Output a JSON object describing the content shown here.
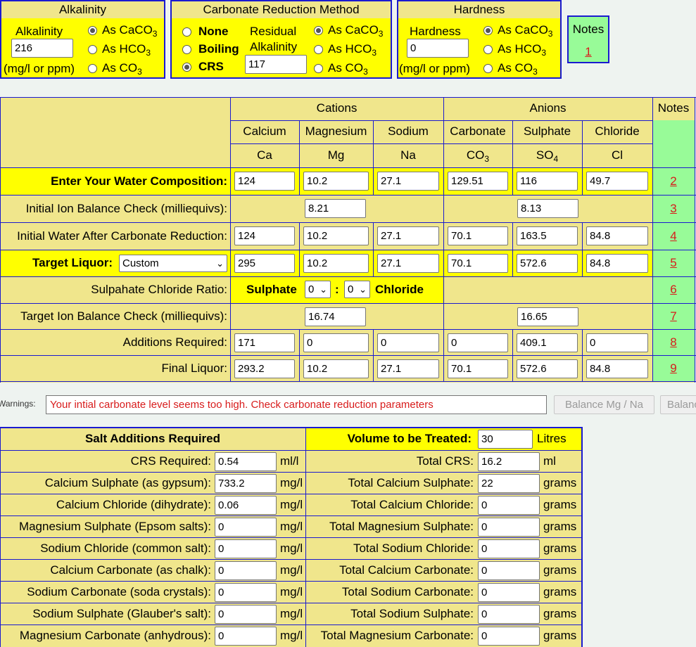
{
  "alkalinity": {
    "title": "Alkalinity",
    "label": "Alkalinity",
    "value": "216",
    "unit": "(mg/l or ppm)",
    "options": [
      {
        "pre": "As CaCO",
        "sub": "3",
        "selected": true
      },
      {
        "pre": "As HCO",
        "sub": "3",
        "selected": false
      },
      {
        "pre": "As CO",
        "sub": "3",
        "selected": false
      }
    ]
  },
  "reduction": {
    "title": "Carbonate Reduction Method",
    "methods": [
      {
        "label": "None",
        "selected": false
      },
      {
        "label": "Boiling",
        "selected": false
      },
      {
        "label": "CRS",
        "selected": true
      }
    ],
    "residual_label_1": "Residual",
    "residual_label_2": "Alkalinity",
    "residual_value": "117",
    "options": [
      {
        "pre": "As CaCO",
        "sub": "3",
        "selected": true
      },
      {
        "pre": "As HCO",
        "sub": "3",
        "selected": false
      },
      {
        "pre": "As CO",
        "sub": "3",
        "selected": false
      }
    ]
  },
  "hardness": {
    "title": "Hardness",
    "label": "Hardness",
    "value": "0",
    "unit": "(mg/l or ppm)",
    "options": [
      {
        "pre": "As CaCO",
        "sub": "3",
        "selected": true
      },
      {
        "pre": "As HCO",
        "sub": "3",
        "selected": false
      },
      {
        "pre": "As CO",
        "sub": "3",
        "selected": false
      }
    ]
  },
  "notes_box": {
    "title": "Notes",
    "link": "1"
  },
  "main": {
    "cations_header": "Cations",
    "anions_header": "Anions",
    "notes_header": "Notes",
    "columns": [
      {
        "name": "Calcium",
        "sym_pre": "Ca",
        "sym_sub": ""
      },
      {
        "name": "Magnesium",
        "sym_pre": "Mg",
        "sym_sub": ""
      },
      {
        "name": "Sodium",
        "sym_pre": "Na",
        "sym_sub": ""
      },
      {
        "name": "Carbonate",
        "sym_pre": "CO",
        "sym_sub": "3"
      },
      {
        "name": "Sulphate",
        "sym_pre": "SO",
        "sym_sub": "4"
      },
      {
        "name": "Chloride",
        "sym_pre": "Cl",
        "sym_sub": ""
      }
    ],
    "rows": [
      {
        "label": "Enter Your Water Composition:",
        "bold": true,
        "yellow": true,
        "values": [
          "124",
          "10.2",
          "27.1",
          "129.51",
          "116",
          "49.7"
        ],
        "note": "2"
      },
      {
        "label": "Initial Ion Balance Check (milliequivs):",
        "cation_balance": "8.21",
        "anion_balance": "8.13",
        "note": "3"
      },
      {
        "label": "Initial Water After Carbonate Reduction:",
        "values": [
          "124",
          "10.2",
          "27.1",
          "70.1",
          "163.5",
          "84.8"
        ],
        "note": "4"
      },
      {
        "label": "Target Liquor:",
        "bold": true,
        "yellow": true,
        "select": "Custom",
        "values": [
          "295",
          "10.2",
          "27.1",
          "70.1",
          "572.6",
          "84.8"
        ],
        "note": "5"
      },
      {
        "label": "Sulpahate Chloride Ratio:",
        "ratio": {
          "left": "Sulphate",
          "a": "0",
          "sep": ":",
          "b": "0",
          "right": "Chloride"
        },
        "note": "6"
      },
      {
        "label": "Target Ion Balance Check (milliequivs):",
        "cation_balance": "16.74",
        "anion_balance": "16.65",
        "note": "7"
      },
      {
        "label": "Additions Required:",
        "values": [
          "171",
          "0",
          "0",
          "0",
          "409.1",
          "0"
        ],
        "note": "8"
      },
      {
        "label": "Final Liquor:",
        "values": [
          "293.2",
          "10.2",
          "27.1",
          "70.1",
          "572.6",
          "84.8"
        ],
        "note": "9"
      }
    ]
  },
  "warnings": {
    "label": "Warnings:",
    "message": "Your intial carbonate level seems too high. Check carbonate reduction parameters",
    "buttons": [
      "Balance Mg / Na",
      "Balance"
    ]
  },
  "salts": {
    "header": "Salt Additions Required",
    "volume_label": "Volume to be Treated:",
    "volume_value": "30",
    "volume_unit": "Litres",
    "rows": [
      {
        "label": "CRS Required:",
        "value": "0.54",
        "unit": "ml/l",
        "total_label": "Total CRS:",
        "total": "16.2",
        "total_unit": "ml"
      },
      {
        "label": "Calcium Sulphate (as gypsum):",
        "value": "733.2",
        "unit": "mg/l",
        "total_label": "Total Calcium Sulphate:",
        "total": "22",
        "total_unit": "grams"
      },
      {
        "label": "Calcium Chloride (dihydrate):",
        "value": "0.06",
        "unit": "mg/l",
        "total_label": "Total Calcium Chloride:",
        "total": "0",
        "total_unit": "grams"
      },
      {
        "label": "Magnesium Sulphate (Epsom salts):",
        "value": "0",
        "unit": "mg/l",
        "total_label": "Total Magnesium Sulphate:",
        "total": "0",
        "total_unit": "grams"
      },
      {
        "label": "Sodium Chloride (common salt):",
        "value": "0",
        "unit": "mg/l",
        "total_label": "Total Sodium Chloride:",
        "total": "0",
        "total_unit": "grams"
      },
      {
        "label": "Calcium Carbonate (as chalk):",
        "value": "0",
        "unit": "mg/l",
        "total_label": "Total Calcium Carbonate:",
        "total": "0",
        "total_unit": "grams"
      },
      {
        "label": "Sodium Carbonate (soda crystals):",
        "value": "0",
        "unit": "mg/l",
        "total_label": "Total Sodium Carbonate:",
        "total": "0",
        "total_unit": "grams"
      },
      {
        "label": "Sodium Sulphate (Glauber's salt):",
        "value": "0",
        "unit": "mg/l",
        "total_label": "Total Sodium Sulphate:",
        "total": "0",
        "total_unit": "grams"
      },
      {
        "label": "Magnesium Carbonate (anhydrous):",
        "value": "0",
        "unit": "mg/l",
        "total_label": "Total Magnesium Carbonate:",
        "total": "0",
        "total_unit": "grams"
      }
    ]
  }
}
